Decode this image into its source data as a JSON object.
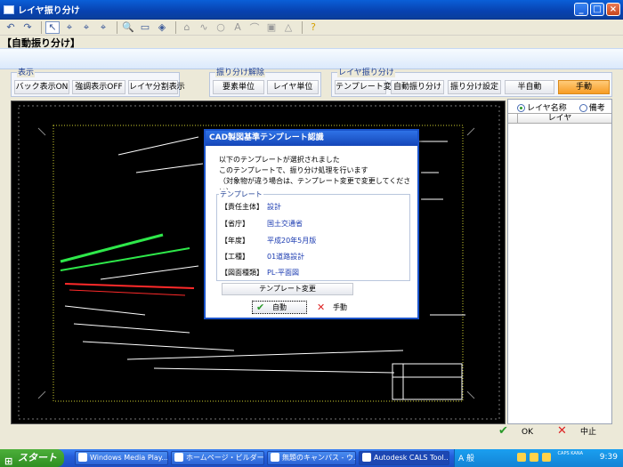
{
  "window": {
    "title": "レイヤ振り分け",
    "min": "_",
    "max": "□",
    "close": "×"
  },
  "page_title": "【自動振り分け】",
  "groups": {
    "display": {
      "label": "表示",
      "buttons": [
        "バック表示ON",
        "強調表示OFF",
        "レイヤ分割表示"
      ]
    },
    "release": {
      "label": "振り分け解除",
      "buttons": [
        "要素単位",
        "レイヤ単位"
      ]
    },
    "layer_assign": {
      "label": "レイヤ振り分け",
      "buttons": [
        "テンプレート変更",
        "自動振り分け",
        "振り分け設定",
        "半自動",
        "手動"
      ]
    }
  },
  "right_panel": {
    "radio_layer_name": "レイヤ名称",
    "radio_remarks": "備考",
    "list_header": "レイヤ"
  },
  "dialog": {
    "title": "CAD製図基準テンプレート認識",
    "message": [
      "以下のテンプレートが選択されました",
      "このテンプレートで、振り分け処理を行います",
      "（対象物が違う場合は、テンプレート変更で変更してください）"
    ],
    "fieldset_label": "テンプレート",
    "fields": [
      {
        "key": "【責任主体】",
        "value": "設計"
      },
      {
        "key": "【省庁】",
        "value": "国土交通省"
      },
      {
        "key": "【年度】",
        "value": "平成20年5月版"
      },
      {
        "key": "【工種】",
        "value": "01道路設計"
      },
      {
        "key": "【図面種類】",
        "value": "PL-平面図"
      }
    ],
    "template_change": "テンプレート変更",
    "auto": "自動",
    "manual": "手動"
  },
  "bottom": {
    "ok": "OK",
    "cancel": "中止"
  },
  "taskbar": {
    "start": "スタート",
    "tasks": [
      "Windows Media Play...",
      "ホームページ・ビルダー...",
      "無題のキャンバス - ウ...",
      "Autodesk CALS Tool..."
    ],
    "ime": "A 般",
    "caps": "CAPS\nKANA",
    "clock": "9:39"
  },
  "colors": {
    "accent_orange": "#f79c24",
    "title_blue": "#0842b0",
    "cad_green": "#2ee84a",
    "cad_red": "#ff2a2a"
  },
  "icons": [
    "undo-icon",
    "redo-icon",
    "pointer-icon",
    "lasso-icon",
    "lasso-plus-icon",
    "lasso-minus-icon",
    "zoom-icon",
    "page-icon",
    "layers-icon",
    "help-icon"
  ]
}
